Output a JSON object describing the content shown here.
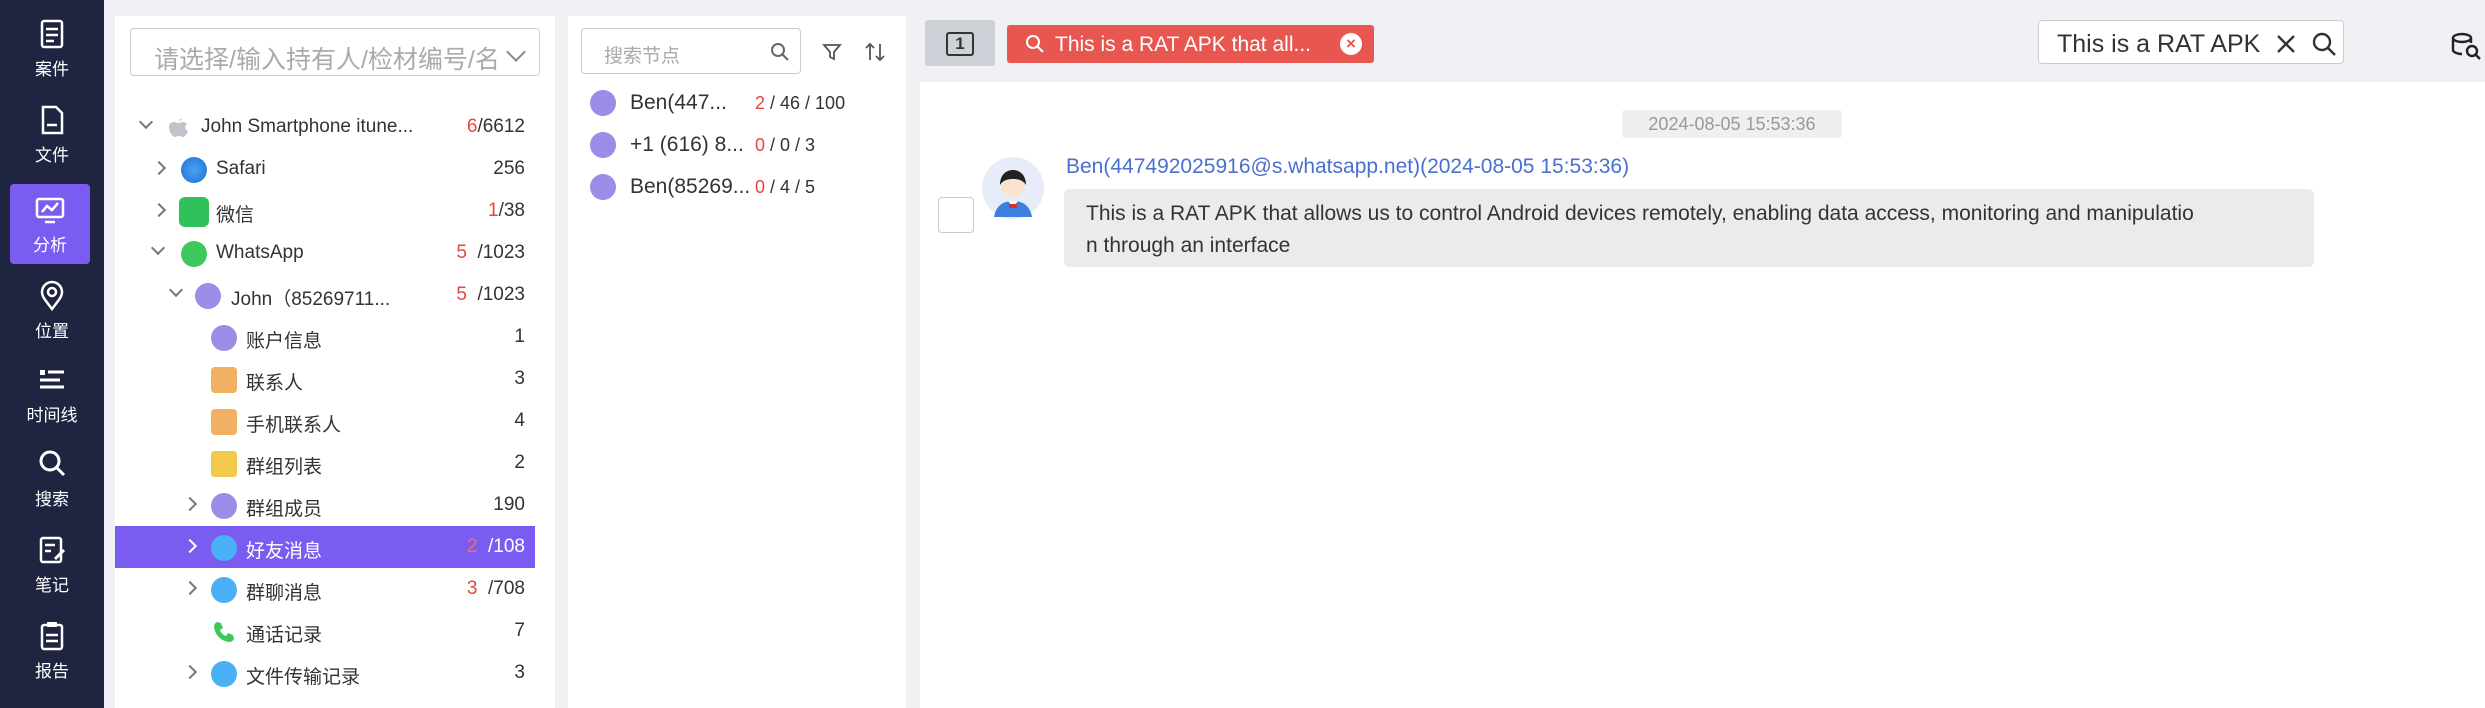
{
  "nav": [
    {
      "label": "案件",
      "icon": "case-icon"
    },
    {
      "label": "文件",
      "icon": "file-icon"
    },
    {
      "label": "分析",
      "icon": "analysis-icon"
    },
    {
      "label": "位置",
      "icon": "location-icon"
    },
    {
      "label": "时间线",
      "icon": "timeline-icon"
    },
    {
      "label": "搜索",
      "icon": "search-icon"
    },
    {
      "label": "笔记",
      "icon": "note-icon"
    },
    {
      "label": "报告",
      "icon": "report-icon"
    }
  ],
  "tree": {
    "select_placeholder": "请选择/输入持有人/检材编号/名称",
    "rows": [
      {
        "label": "John Smartphone  itune...",
        "red": "6",
        "total": "/6612"
      },
      {
        "label": "Safari",
        "red": "",
        "total": "256"
      },
      {
        "label": "微信",
        "red": "1",
        "total": "/38"
      },
      {
        "label": "WhatsApp",
        "red": "5",
        "total": "/1023"
      },
      {
        "label": "John（85269711...",
        "red": "5",
        "total": "/1023"
      },
      {
        "label": "账户信息",
        "red": "",
        "total": "1"
      },
      {
        "label": "联系人",
        "red": "",
        "total": "3"
      },
      {
        "label": "手机联系人",
        "red": "",
        "total": "4"
      },
      {
        "label": "群组列表",
        "red": "",
        "total": "2"
      },
      {
        "label": "群组成员",
        "red": "",
        "total": "190"
      },
      {
        "label": "好友消息",
        "red": "2",
        "total": "/108"
      },
      {
        "label": "群聊消息",
        "red": "3",
        "total": "/708"
      },
      {
        "label": "通话记录",
        "red": "",
        "total": "7"
      },
      {
        "label": "文件传输记录",
        "red": "",
        "total": "3"
      }
    ]
  },
  "nodes": {
    "search_placeholder": "搜索节点",
    "items": [
      {
        "label": "Ben(447...",
        "red": "2",
        "rest": " / 46 / 100"
      },
      {
        "label": "+1 (616) 8...",
        "red": "0",
        "rest": " / 0 / 3"
      },
      {
        "label": "Ben(85269...",
        "red": "0",
        "rest": " / 4 / 5"
      }
    ]
  },
  "topbar": {
    "toggle_label": "1",
    "tag_label": "This is a RAT APK that all...",
    "search_value": "This is a RAT APK that allows"
  },
  "chat": {
    "timestamp": "2024-08-05 15:53:36",
    "sender": "Ben(447492025916@s.whatsapp.net)(2024-08-05 15:53:36)",
    "message_line1": "This is a RAT APK that allows us to control Android devices remotely, enabling data access, monitoring and manipulatio",
    "message_line2": "n through an interface"
  },
  "colors": {
    "accent": "#7a5cf0",
    "nav_bg": "#1f2440",
    "count_red": "#e8453c",
    "tag_red": "#e8574f",
    "link_blue": "#4a6fd1"
  }
}
